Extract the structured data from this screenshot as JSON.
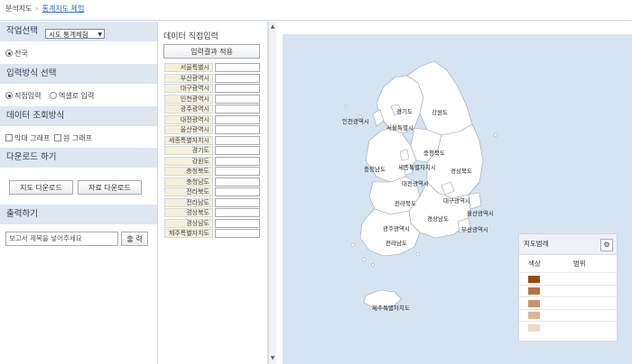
{
  "breadcrumb": {
    "root": "분석지도",
    "current": "통계지도 체험"
  },
  "left": {
    "task": {
      "title": "작업선택",
      "select_value": "시도 통계체험",
      "radio_label": "전국"
    },
    "input_method": {
      "title": "입력방식 선택",
      "direct": "직접입력",
      "excel": "엑셀로 입력"
    },
    "query": {
      "title": "데이터 조회방식",
      "bar": "막대 그래프",
      "pie": "원 그래프"
    },
    "download": {
      "title": "다운로드 하기",
      "map_btn": "지도 다운로드",
      "data_btn": "자료 다운로드"
    },
    "print": {
      "title": "출력하기",
      "placeholder": "보고서 제목을 넣어주세요",
      "btn": "출 력"
    }
  },
  "mid": {
    "title": "데이터 직접입력",
    "apply": "입력결과 적용",
    "regions": [
      "서울특별시",
      "부산광역시",
      "대구광역시",
      "인천광역시",
      "광주광역시",
      "대전광역시",
      "울산광역시",
      "세종특별자치시",
      "경기도",
      "강원도",
      "충청북도",
      "충청남도",
      "전라북도",
      "전라남도",
      "경상북도",
      "경상남도",
      "제주특별자치도"
    ]
  },
  "map": {
    "labels": [
      "경기도",
      "강원도",
      "인천광역시",
      "서울특별시",
      "충청북도",
      "세종특별자치시",
      "충청남도",
      "대전광역시",
      "경상북도",
      "대구광역시",
      "전라북도",
      "울산광역시",
      "경상남도",
      "광주광역시",
      "부산광역시",
      "전라남도",
      "제주특별자치도"
    ],
    "fill_color": "#ffffff",
    "sea_color": "#d6e3f1"
  },
  "legend": {
    "title": "지도범례",
    "col_color": "색상",
    "col_range": "범위",
    "colors": [
      "#9c4a0e",
      "#b8733c",
      "#c9926a",
      "#dcb597",
      "#ecd9ca"
    ]
  }
}
